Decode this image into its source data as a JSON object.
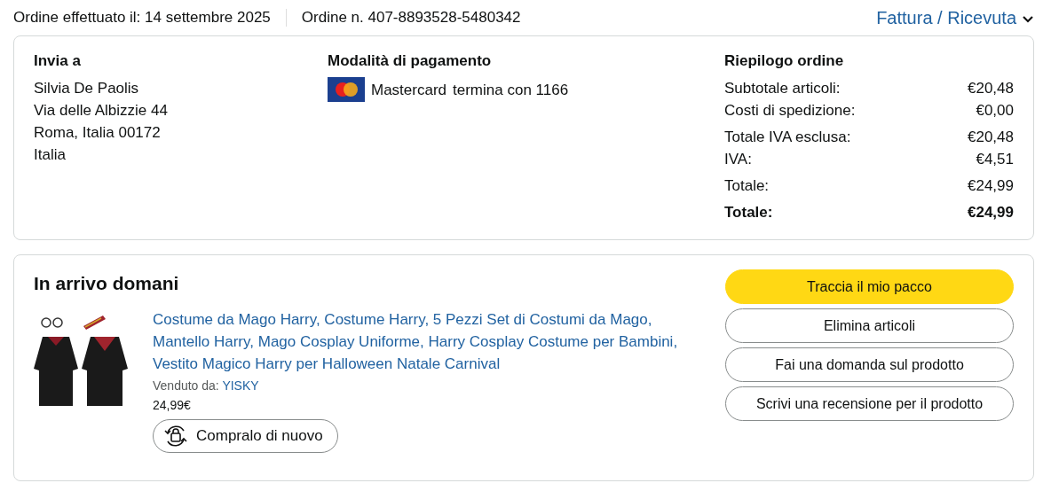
{
  "header": {
    "order_date": "Ordine effettuato il: 14 settembre 2025",
    "order_number": "Ordine n. 407-8893528-5480342",
    "invoice_link": "Fattura / Ricevuta"
  },
  "shipping": {
    "title": "Invia a",
    "lines": [
      "Silvia De Paolis",
      "Via delle Albizzie 44",
      "Roma, Italia 00172",
      "Italia"
    ]
  },
  "payment": {
    "title": "Modalità di pagamento",
    "card": "Mastercard",
    "ending": "termina con 1166"
  },
  "summary": {
    "title": "Riepilogo ordine",
    "groups": [
      [
        {
          "label": "Subtotale articoli:",
          "value": "€20,48",
          "bold": false
        },
        {
          "label": "Costi di spedizione:",
          "value": "€0,00",
          "bold": false
        }
      ],
      [
        {
          "label": "Totale IVA esclusa:",
          "value": "€20,48",
          "bold": false
        },
        {
          "label": "IVA:",
          "value": "€4,51",
          "bold": false
        }
      ],
      [
        {
          "label": "Totale:",
          "value": "€24,99",
          "bold": false
        }
      ],
      [
        {
          "label": "Totale:",
          "value": "€24,99",
          "bold": true
        }
      ]
    ]
  },
  "shipment": {
    "status": "In arrivo domani",
    "product": {
      "title": "Costume da Mago Harry, Costume Harry, 5 Pezzi Set di Costumi da Mago, Mantello Harry, Mago Cosplay Uniforme, Harry Cosplay Costume per Bambini, Vestito Magico Harry per Halloween Natale Carnival",
      "sold_by_label": "Venduto da:",
      "seller": "YISKY",
      "price": "24,99€",
      "buy_again": "Compralo di nuovo"
    },
    "actions": [
      {
        "label": "Traccia il mio pacco",
        "kind": "primary"
      },
      {
        "label": "Elimina articoli",
        "kind": "secondary"
      },
      {
        "label": "Fai una domanda sul prodotto",
        "kind": "secondary"
      },
      {
        "label": "Scrivi una recensione per il prodotto",
        "kind": "secondary"
      }
    ]
  }
}
